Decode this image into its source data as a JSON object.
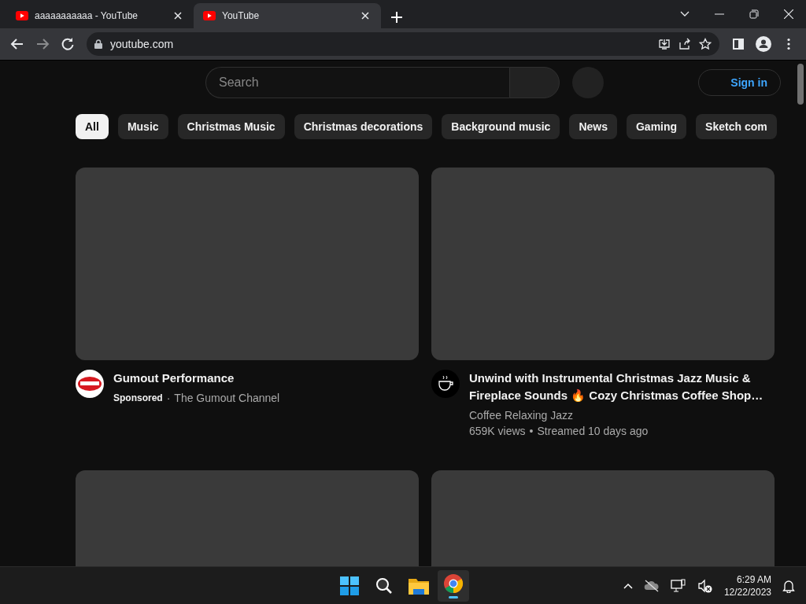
{
  "tabs": [
    {
      "title": "aaaaaaaaaaa - YouTube",
      "selected": false
    },
    {
      "title": "YouTube",
      "selected": true
    }
  ],
  "address": "youtube.com",
  "search": {
    "placeholder": "Search"
  },
  "sign_in": "Sign in",
  "chips": [
    {
      "label": "All",
      "selected": true
    },
    {
      "label": "Music",
      "selected": false
    },
    {
      "label": "Christmas Music",
      "selected": false
    },
    {
      "label": "Christmas decorations",
      "selected": false
    },
    {
      "label": "Background music",
      "selected": false
    },
    {
      "label": "News",
      "selected": false
    },
    {
      "label": "Gaming",
      "selected": false
    },
    {
      "label": "Sketch com",
      "selected": false
    }
  ],
  "videos": [
    {
      "kind": "ad",
      "title": "Gumout Performance",
      "badge": "Sponsored",
      "separator": "·",
      "channel": "The Gumout Channel"
    },
    {
      "kind": "video",
      "title": "Unwind with Instrumental Christmas Jazz Music & Fireplace Sounds 🔥 Cozy Christmas Coffee Shop…",
      "channel": "Coffee Relaxing Jazz",
      "views": "659K views",
      "separator": "•",
      "age": "Streamed 10 days ago"
    },
    {
      "kind": "loading"
    },
    {
      "kind": "loading"
    }
  ],
  "taskbar": {
    "time": "6:29 AM",
    "date": "12/22/2023"
  }
}
